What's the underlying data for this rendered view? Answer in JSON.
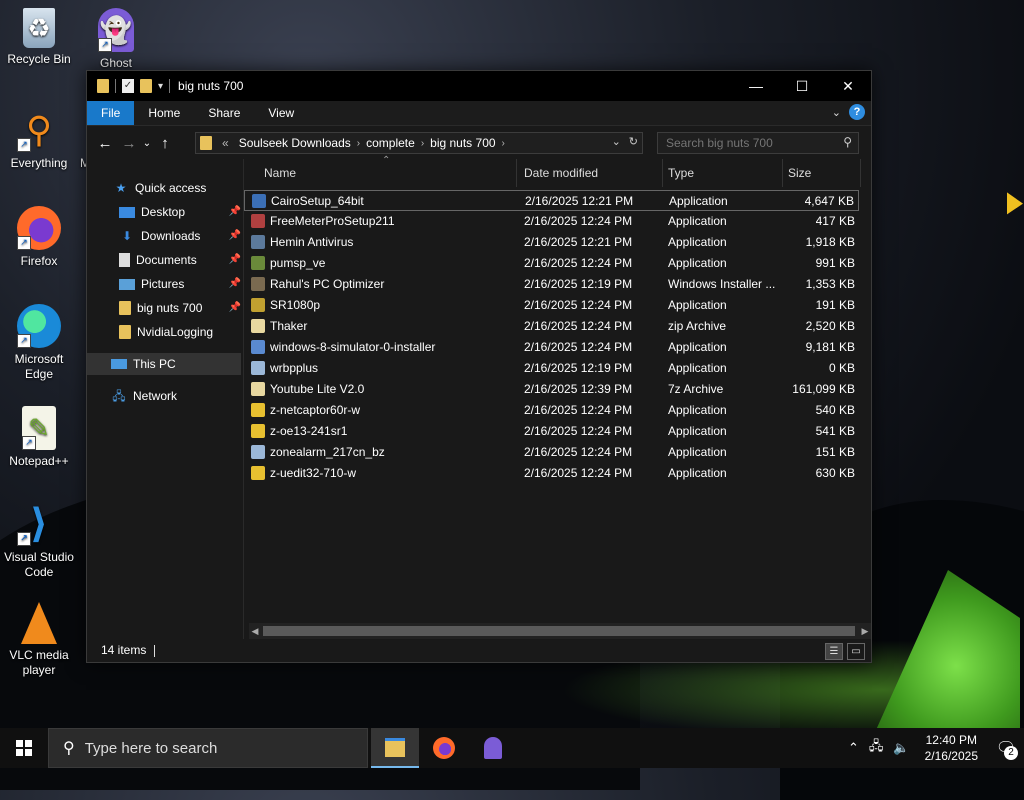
{
  "desktop": {
    "icons": [
      {
        "label": "Recycle Bin",
        "icon": "recycle-bin-icon"
      },
      {
        "label": "Ghost",
        "icon": "ghost-icon"
      },
      {
        "label": "Everything",
        "icon": "everything-search-icon"
      },
      {
        "label": "M",
        "icon": "app-icon"
      },
      {
        "label": "Firefox",
        "icon": "firefox-icon"
      },
      {
        "label": "Microsoft Edge",
        "icon": "edge-icon"
      },
      {
        "label": "Notepad++",
        "icon": "notepadpp-icon"
      },
      {
        "label": "Visual Studio Code",
        "icon": "vscode-icon"
      },
      {
        "label": "VLC media player",
        "icon": "vlc-icon"
      }
    ]
  },
  "window": {
    "title": "big nuts 700",
    "controls": {
      "minimize": "—",
      "maximize": "☐",
      "close": "✕"
    },
    "ribbon": {
      "tabs": [
        "File",
        "Home",
        "Share",
        "View"
      ],
      "help": "?"
    },
    "address": {
      "prefix": "«",
      "crumbs": [
        "Soulseek Downloads",
        "complete",
        "big nuts 700"
      ]
    },
    "search_placeholder": "Search big nuts 700",
    "nav": {
      "quick_access": "Quick access",
      "items": [
        {
          "label": "Desktop",
          "pinned": true
        },
        {
          "label": "Downloads",
          "pinned": true
        },
        {
          "label": "Documents",
          "pinned": true
        },
        {
          "label": "Pictures",
          "pinned": true
        },
        {
          "label": "big nuts 700",
          "pinned": true
        },
        {
          "label": "NvidiaLogging",
          "pinned": false
        }
      ],
      "this_pc": "This PC",
      "network": "Network"
    },
    "columns": {
      "name": "Name",
      "date": "Date modified",
      "type": "Type",
      "size": "Size"
    },
    "files": [
      {
        "name": "CairoSetup_64bit",
        "date": "2/16/2025 12:21 PM",
        "type": "Application",
        "size": "4,647 KB",
        "color": "#3b6fb6"
      },
      {
        "name": "FreeMeterProSetup211",
        "date": "2/16/2025 12:24 PM",
        "type": "Application",
        "size": "417 KB",
        "color": "#b04040"
      },
      {
        "name": "Hemin Antivirus",
        "date": "2/16/2025 12:21 PM",
        "type": "Application",
        "size": "1,918 KB",
        "color": "#5c7a9c"
      },
      {
        "name": "pumsp_ve",
        "date": "2/16/2025 12:24 PM",
        "type": "Application",
        "size": "991 KB",
        "color": "#6a8a3a"
      },
      {
        "name": "Rahul's PC Optimizer",
        "date": "2/16/2025 12:19 PM",
        "type": "Windows Installer ...",
        "size": "1,353 KB",
        "color": "#7a6a50"
      },
      {
        "name": "SR1080p",
        "date": "2/16/2025 12:24 PM",
        "type": "Application",
        "size": "191 KB",
        "color": "#c0a030"
      },
      {
        "name": "Thaker",
        "date": "2/16/2025 12:24 PM",
        "type": "zip Archive",
        "size": "2,520 KB",
        "color": "#e8d8a0"
      },
      {
        "name": "windows-8-simulator-0-installer",
        "date": "2/16/2025 12:24 PM",
        "type": "Application",
        "size": "9,181 KB",
        "color": "#5a8ad0"
      },
      {
        "name": "wrbpplus",
        "date": "2/16/2025 12:19 PM",
        "type": "Application",
        "size": "0 KB",
        "color": "#9cb8d8"
      },
      {
        "name": "Youtube Lite V2.0",
        "date": "2/16/2025 12:39 PM",
        "type": "7z Archive",
        "size": "161,099 KB",
        "color": "#e8d8a0"
      },
      {
        "name": "z-netcaptor60r-w",
        "date": "2/16/2025 12:24 PM",
        "type": "Application",
        "size": "540 KB",
        "color": "#e8c030"
      },
      {
        "name": "z-oe13-241sr1",
        "date": "2/16/2025 12:24 PM",
        "type": "Application",
        "size": "541 KB",
        "color": "#e8c030"
      },
      {
        "name": "zonealarm_217cn_bz",
        "date": "2/16/2025 12:24 PM",
        "type": "Application",
        "size": "151 KB",
        "color": "#9cb8d8"
      },
      {
        "name": "z-uedit32-710-w",
        "date": "2/16/2025 12:24 PM",
        "type": "Application",
        "size": "630 KB",
        "color": "#e8c030"
      }
    ],
    "status": {
      "count": "14 items"
    }
  },
  "taskbar": {
    "search_placeholder": "Type here to search",
    "time": "12:40 PM",
    "date": "2/16/2025",
    "notifications": "2"
  }
}
